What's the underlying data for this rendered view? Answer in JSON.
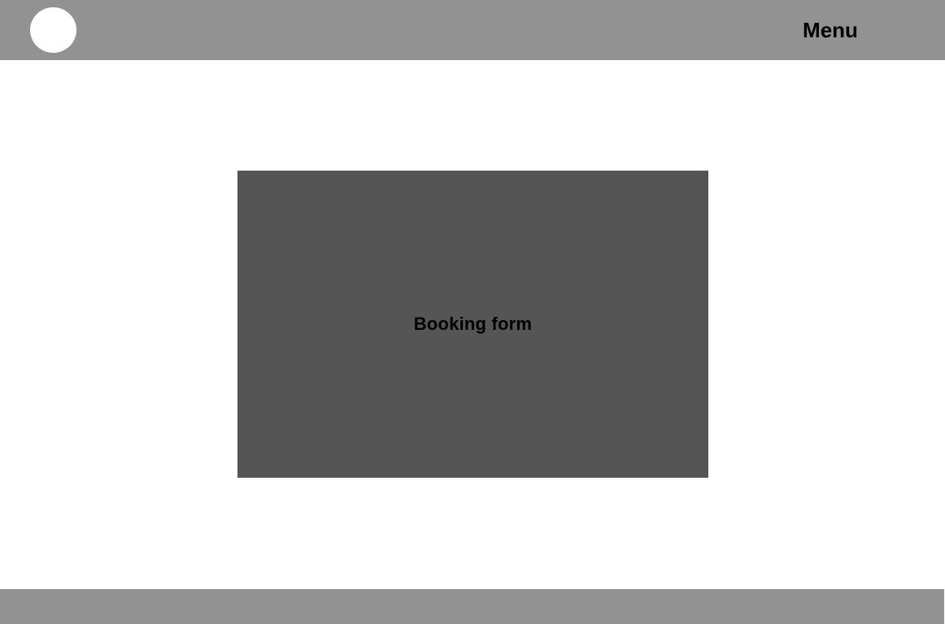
{
  "header": {
    "logo_icon": "circle-logo",
    "menu_label": "Menu"
  },
  "main": {
    "booking_form_label": "Booking form"
  },
  "colors": {
    "header_bg": "#929292",
    "footer_bg": "#929292",
    "form_bg": "#555555",
    "logo": "#ffffff",
    "page_bg": "#ffffff",
    "text": "#000000"
  }
}
